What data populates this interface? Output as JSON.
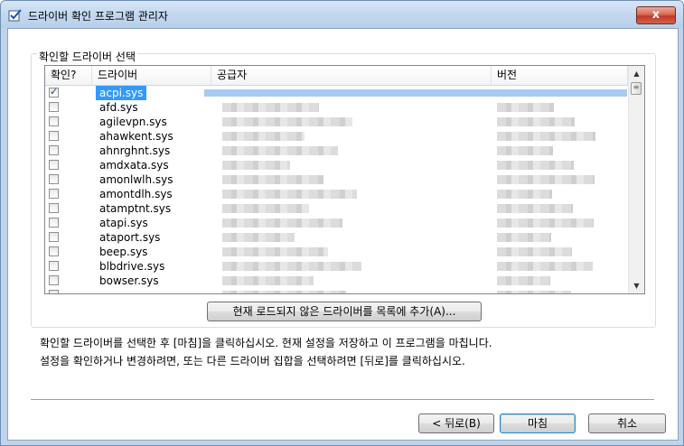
{
  "window": {
    "title": "드라이버 확인 프로그램 관리자",
    "close_label": "x"
  },
  "group": {
    "label": "확인할 드라이버 선택"
  },
  "columns": {
    "check": "확인?",
    "driver": "드라이버",
    "vendor": "공급자",
    "version": "버전"
  },
  "rows": [
    {
      "name": "acpi.sys",
      "checked": true,
      "selected": true
    },
    {
      "name": "afd.sys",
      "checked": false
    },
    {
      "name": "agilevpn.sys",
      "checked": false
    },
    {
      "name": "ahawkent.sys",
      "checked": false
    },
    {
      "name": "ahnrghnt.sys",
      "checked": false
    },
    {
      "name": "amdxata.sys",
      "checked": false
    },
    {
      "name": "amonlwlh.sys",
      "checked": false
    },
    {
      "name": "amontdlh.sys",
      "checked": false
    },
    {
      "name": "atamptnt.sys",
      "checked": false
    },
    {
      "name": "atapi.sys",
      "checked": false
    },
    {
      "name": "ataport.sys",
      "checked": false
    },
    {
      "name": "beep.sys",
      "checked": false
    },
    {
      "name": "blbdrive.sys",
      "checked": false
    },
    {
      "name": "bowser.sys",
      "checked": false
    },
    {
      "name": "",
      "checked": false
    }
  ],
  "add_button": {
    "label": "현재 로드되지 않은 드라이버를 목록에 추가(A)..."
  },
  "instructions": [
    "확인할 드라이버를 선택한 후 [마침]을 클릭하십시오. 현재 설정을 저장하고 이 프로그램을 마칩니다.",
    "설정을 확인하거나 변경하려면, 또는 다른 드라이버 집합을 선택하려면 [뒤로]를 클릭하십시오."
  ],
  "buttons": {
    "back": "< 뒤로(B)",
    "finish": "마침",
    "cancel": "취소"
  }
}
